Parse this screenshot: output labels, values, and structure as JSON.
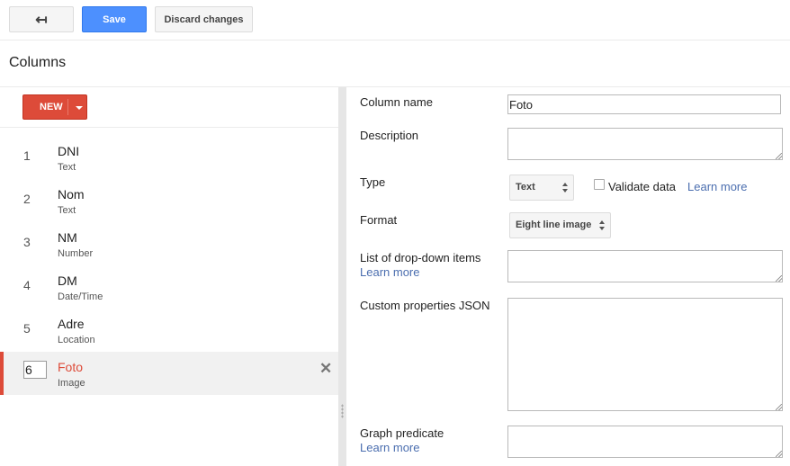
{
  "toolbar": {
    "back_icon": "back-arrow-icon",
    "back_glyph": "↤",
    "save_label": "Save",
    "discard_label": "Discard changes"
  },
  "page": {
    "title": "Columns"
  },
  "new_button": {
    "label": "NEW",
    "caret_icon": "caret-down-icon"
  },
  "columns": [
    {
      "number": "1",
      "name": "DNI",
      "type": "Text"
    },
    {
      "number": "2",
      "name": "Nom",
      "type": "Text"
    },
    {
      "number": "3",
      "name": "NM",
      "type": "Number"
    },
    {
      "number": "4",
      "name": "DM",
      "type": "Date/Time"
    },
    {
      "number": "5",
      "name": "Adre",
      "type": "Location"
    },
    {
      "number": "6",
      "name": "Foto",
      "type": "Image",
      "selected": true
    }
  ],
  "delete_glyph": "✕",
  "form": {
    "column_name_label": "Column name",
    "column_name_value": "Foto",
    "description_label": "Description",
    "description_value": "",
    "type_label": "Type",
    "type_value": "Text",
    "validate_label": "Validate data",
    "validate_checked": false,
    "learn_more": "Learn more",
    "format_label": "Format",
    "format_value": "Eight line image",
    "dropdown_label": "List of drop-down items",
    "dropdown_value": "",
    "custom_json_label": "Custom properties JSON",
    "custom_json_value": "",
    "graph_predicate_label": "Graph predicate",
    "graph_predicate_value": ""
  },
  "colors": {
    "accent_red": "#dd4b39",
    "save_blue": "#4d90fe",
    "link_blue": "#4b6eaf"
  }
}
